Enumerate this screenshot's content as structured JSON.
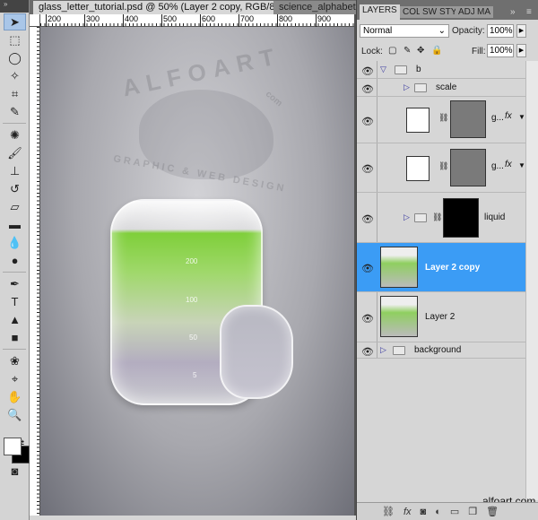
{
  "document": {
    "active_tab": "glass_letter_tutorial.psd @ 50% (Layer 2 copy, RGB/8) *",
    "other_tab": "science_alphabet...",
    "close": "✕"
  },
  "ruler": {
    "h_ticks": [
      "200",
      "300",
      "400",
      "500",
      "600",
      "700",
      "800",
      "900"
    ]
  },
  "artwork": {
    "watermark_top": "ALFOART",
    "watermark_com": "com",
    "watermark_bottom": "GRAPHIC & WEB DESIGN",
    "scale_marks": [
      "200",
      "100",
      "50",
      "5"
    ]
  },
  "tools": [
    "move",
    "marquee",
    "lasso",
    "magic-wand",
    "crop",
    "eyedropper",
    "healing",
    "brush",
    "stamp",
    "history-brush",
    "eraser",
    "gradient",
    "blur",
    "dodge",
    "pen",
    "type",
    "path-select",
    "shape",
    "3d-rotate",
    "3d-orbit",
    "hand",
    "zoom"
  ],
  "layers_panel": {
    "tabs": [
      "LAYERS",
      "COL",
      "SW",
      "STY",
      "ADJ",
      "MA"
    ],
    "blend_mode": "Normal",
    "opacity_label": "Opacity:",
    "opacity": "100%",
    "lock_label": "Lock:",
    "fill_label": "Fill:",
    "fill": "100%",
    "layers": [
      {
        "name": "b",
        "type": "group"
      },
      {
        "name": "scale",
        "type": "group"
      },
      {
        "name": "g...",
        "type": "layer"
      },
      {
        "name": "g...",
        "type": "layer"
      },
      {
        "name": "liquid",
        "type": "group"
      },
      {
        "name": "Layer 2 copy",
        "type": "smart",
        "selected": true
      },
      {
        "name": "Layer 2",
        "type": "smart"
      },
      {
        "name": "background",
        "type": "group"
      }
    ],
    "fx": "fx"
  },
  "credit": "alfoart.com",
  "colors": {
    "accent": "#3b9cf5"
  }
}
